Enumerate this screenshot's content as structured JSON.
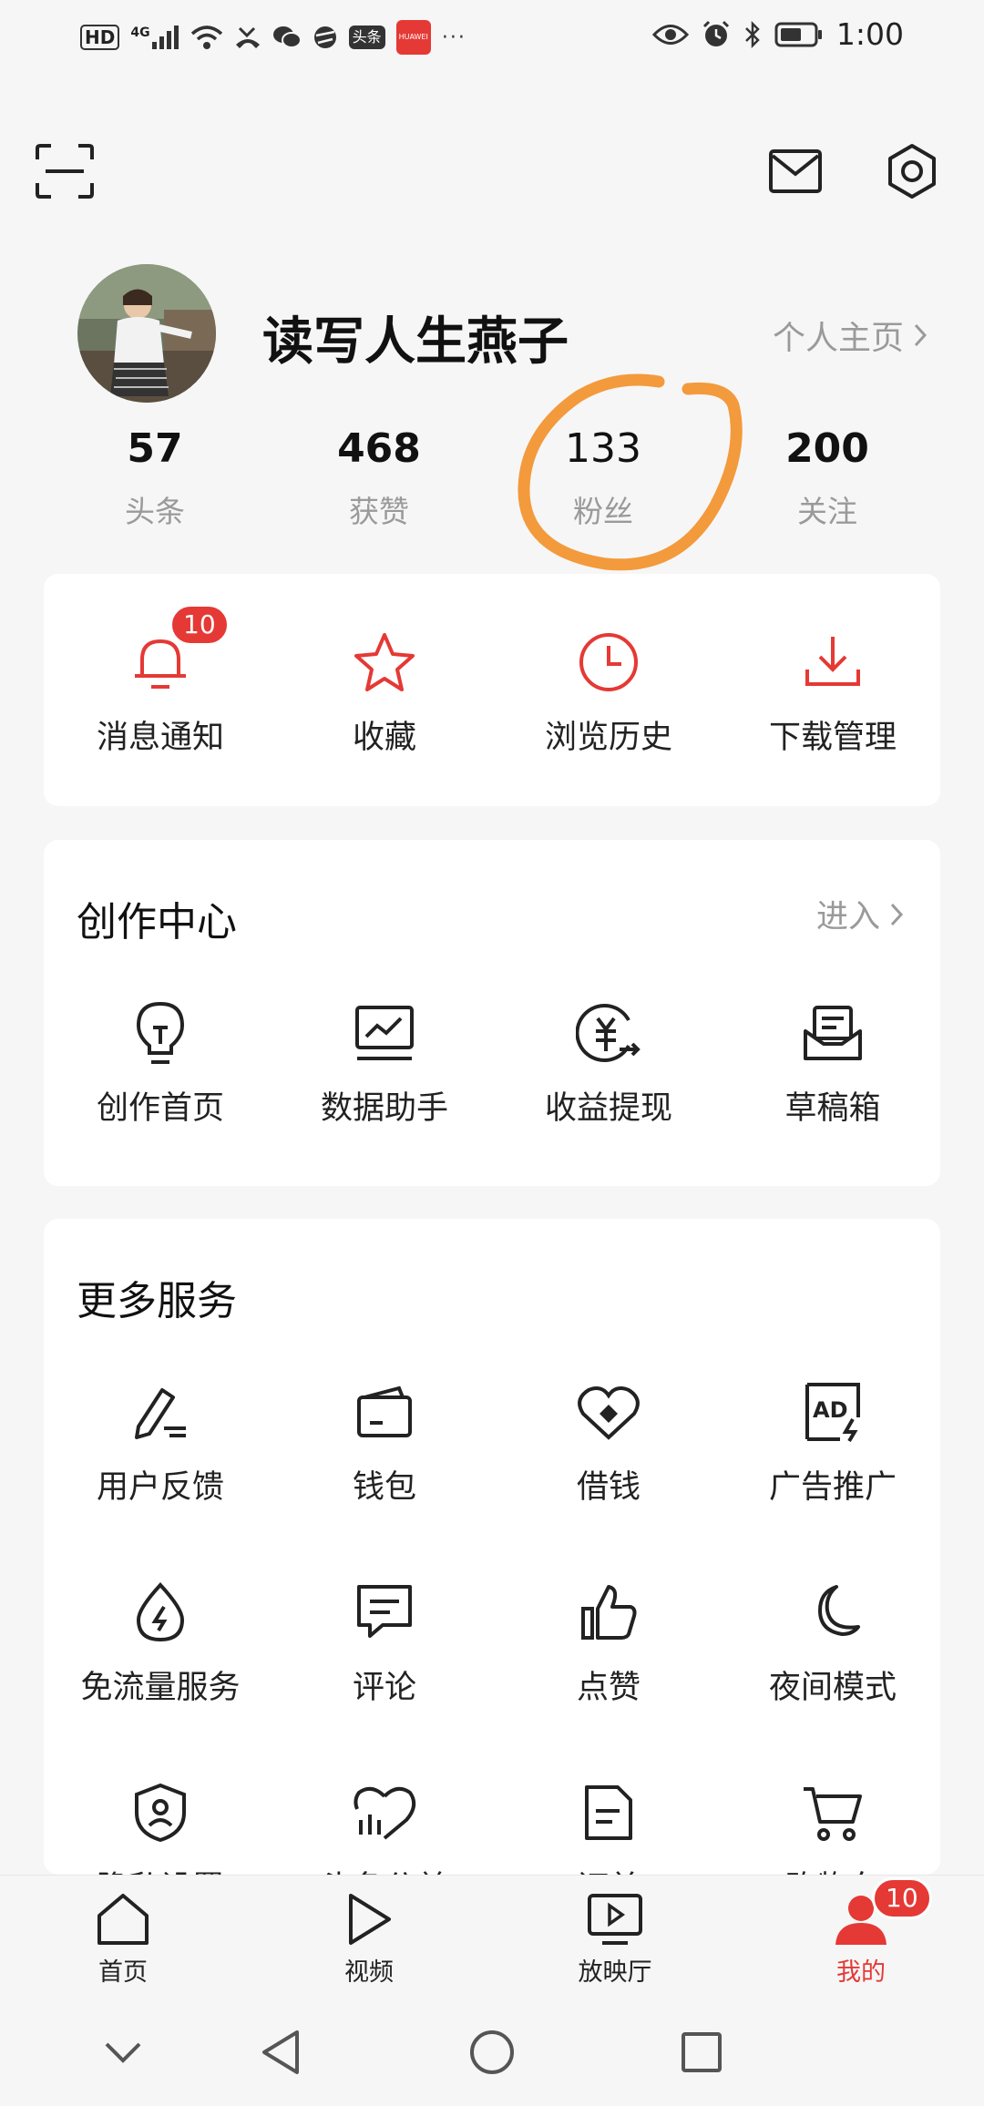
{
  "status_bar": {
    "hd": "HD",
    "network": "4G",
    "app_badge_1": "头条",
    "app_badge_2": "HUAWEI",
    "more": "···",
    "time": "1:00",
    "icons": [
      "signal-icon",
      "wifi-icon",
      "missed-call-icon",
      "wechat-icon",
      "browser-icon",
      "eye-icon",
      "alarm-icon",
      "bluetooth-icon",
      "battery-icon"
    ]
  },
  "header": {
    "scan_icon": "scan-icon",
    "mail_icon": "mail-icon",
    "settings_icon": "gear-icon"
  },
  "profile": {
    "username": "读写人生燕子",
    "homepage_link": "个人主页",
    "stats": [
      {
        "value": "57",
        "label": "头条"
      },
      {
        "value": "468",
        "label": "获赞"
      },
      {
        "value": "133",
        "label": "粉丝"
      },
      {
        "value": "200",
        "label": "关注"
      }
    ]
  },
  "quick_actions": [
    {
      "label": "消息通知",
      "icon": "bell-icon",
      "badge": "10"
    },
    {
      "label": "收藏",
      "icon": "star-icon"
    },
    {
      "label": "浏览历史",
      "icon": "clock-icon"
    },
    {
      "label": "下载管理",
      "icon": "download-icon"
    }
  ],
  "creation_center": {
    "title": "创作中心",
    "enter": "进入",
    "items": [
      {
        "label": "创作首页",
        "icon": "lightbulb-icon"
      },
      {
        "label": "数据助手",
        "icon": "chart-monitor-icon"
      },
      {
        "label": "收益提现",
        "icon": "yuan-withdraw-icon"
      },
      {
        "label": "草稿箱",
        "icon": "draft-box-icon"
      }
    ]
  },
  "more_services": {
    "title": "更多服务",
    "items": [
      {
        "label": "用户反馈",
        "icon": "pen-feedback-icon"
      },
      {
        "label": "钱包",
        "icon": "wallet-icon"
      },
      {
        "label": "借钱",
        "icon": "loan-icon"
      },
      {
        "label": "广告推广",
        "icon": "ad-icon"
      },
      {
        "label": "免流量服务",
        "icon": "data-free-icon"
      },
      {
        "label": "评论",
        "icon": "comment-icon"
      },
      {
        "label": "点赞",
        "icon": "thumbs-up-icon"
      },
      {
        "label": "夜间模式",
        "icon": "moon-icon"
      },
      {
        "label": "隐私设置",
        "icon": "privacy-shield-icon"
      },
      {
        "label": "头条公益",
        "icon": "charity-heart-icon"
      },
      {
        "label": "订单",
        "icon": "order-doc-icon"
      },
      {
        "label": "购物车",
        "icon": "cart-icon"
      }
    ]
  },
  "bottom_nav": {
    "items": [
      {
        "label": "首页",
        "icon": "home-icon"
      },
      {
        "label": "视频",
        "icon": "play-icon"
      },
      {
        "label": "放映厅",
        "icon": "tv-play-icon"
      },
      {
        "label": "我的",
        "icon": "user-icon",
        "badge": "10"
      }
    ]
  },
  "colors": {
    "accent": "#e53935",
    "annotation": "#f39a3c",
    "muted_text": "#9a9a9a",
    "background": "#f6f6f6",
    "card": "#ffffff"
  }
}
